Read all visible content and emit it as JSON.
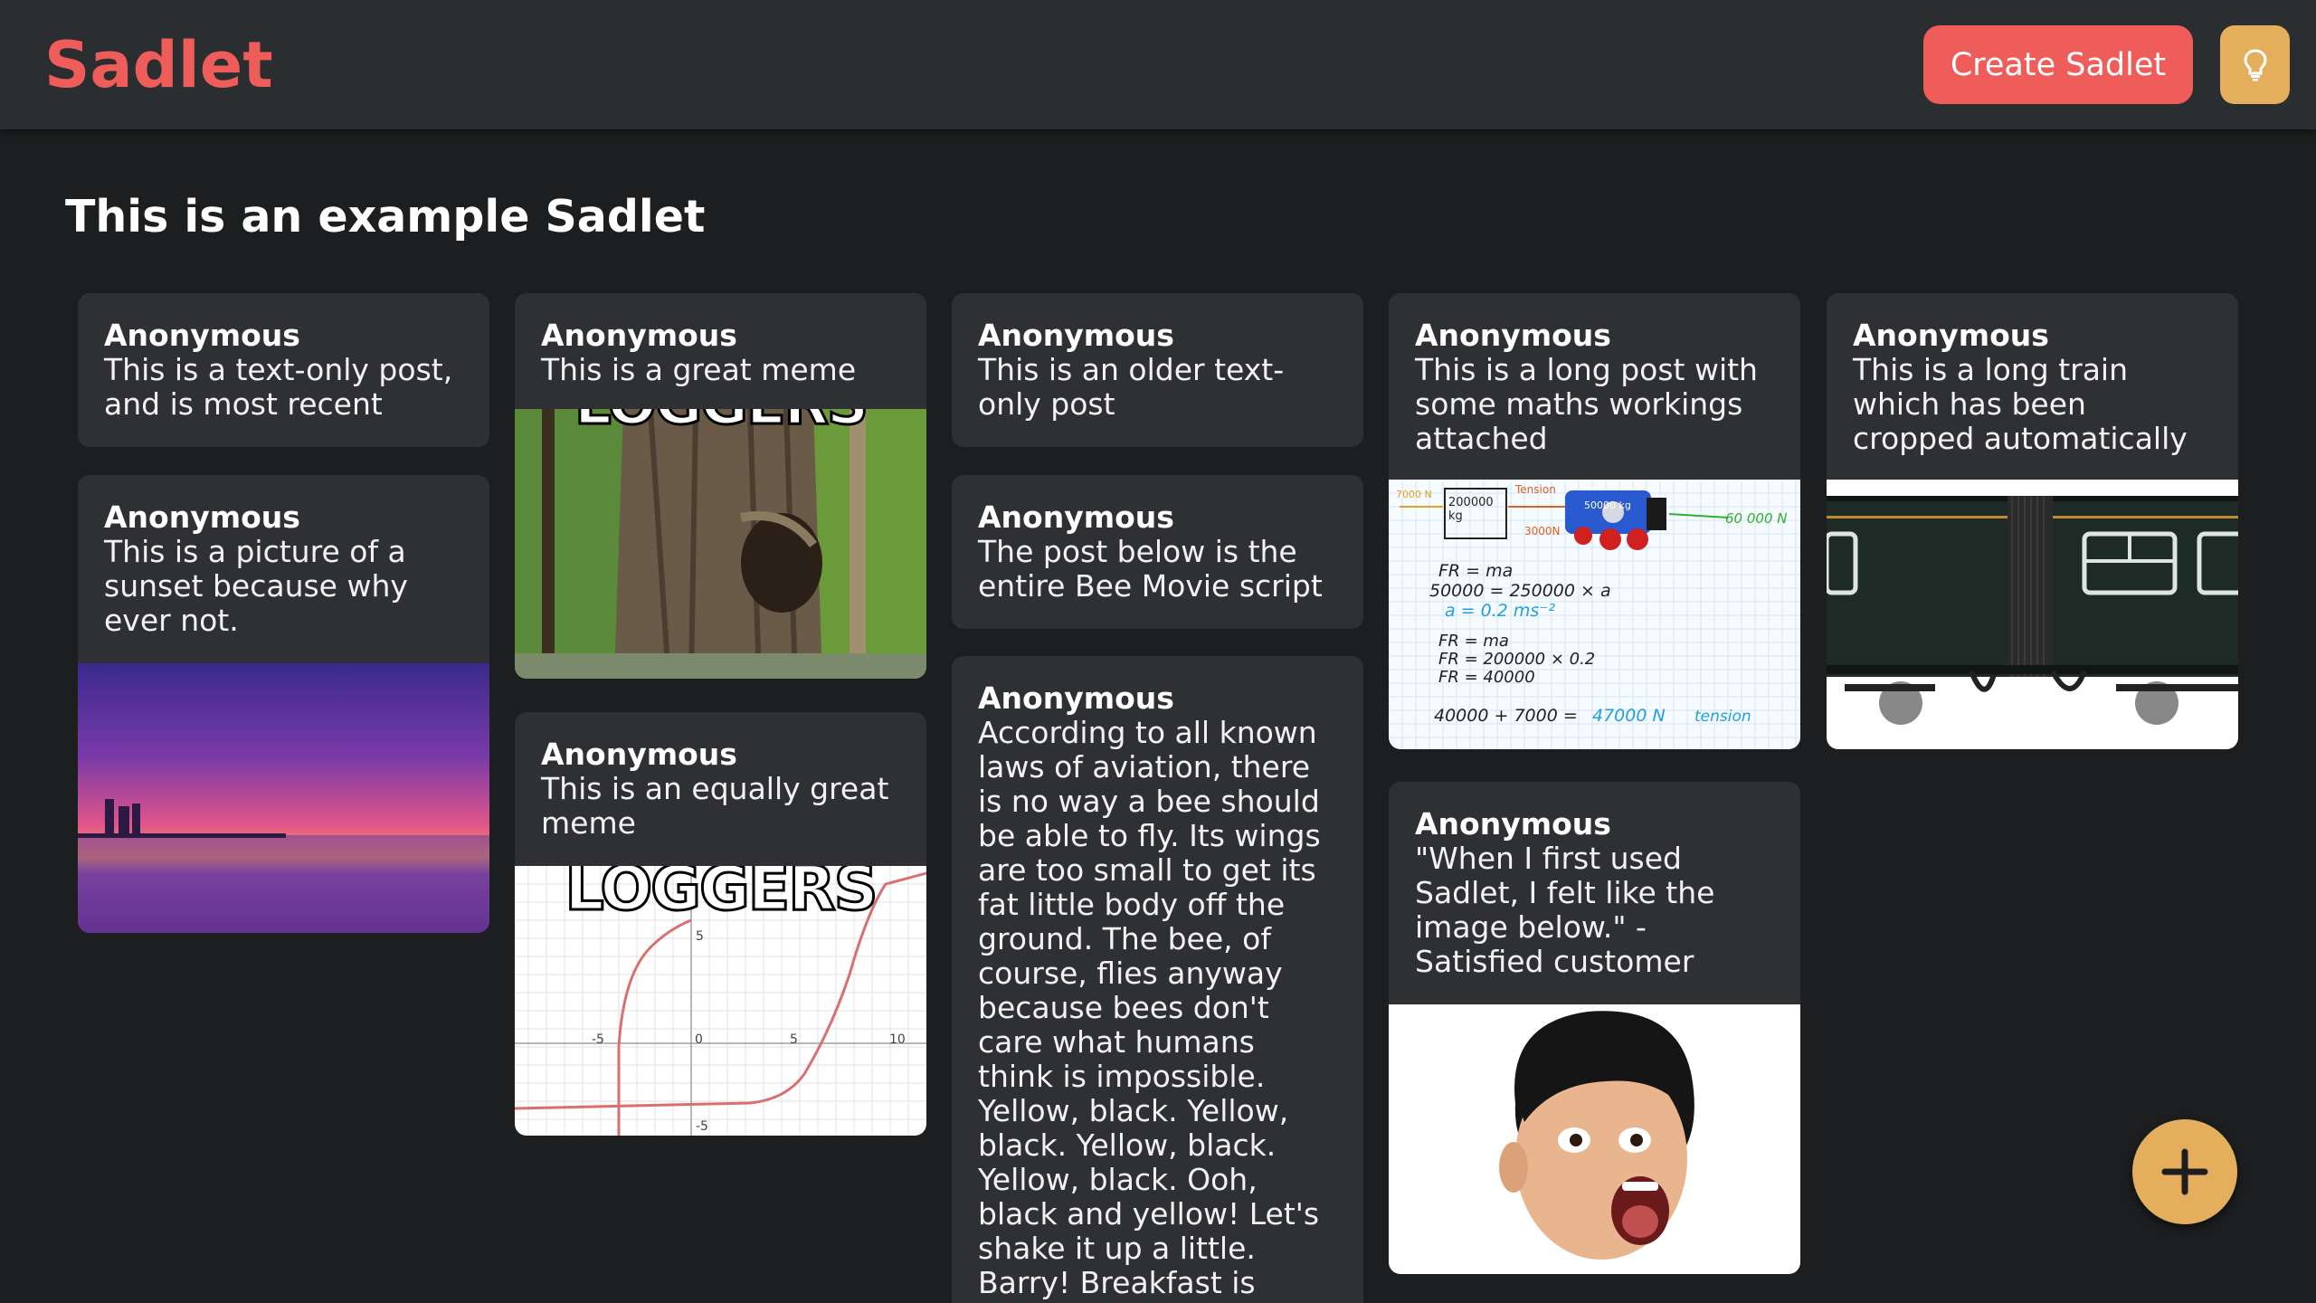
{
  "header": {
    "brand": "Sadlet",
    "create_label": "Create Sadlet"
  },
  "page_title": "This is an example Sadlet",
  "posts": [
    {
      "author": "Anonymous",
      "text": "This is a text-only post, and is most recent"
    },
    {
      "author": "Anonymous",
      "text": "This is a picture of a sunset because why ever not.",
      "image": "sunset-image"
    },
    {
      "author": "Anonymous",
      "text": "This is a great meme",
      "image": "tree-loggers-meme",
      "meme_caption": "LOGGERS"
    },
    {
      "author": "Anonymous",
      "text": "This is an equally great meme",
      "image": "graph-loggers-meme",
      "meme_caption": "LOGGERS",
      "tick_labels": [
        "-5",
        "0",
        "5",
        "10",
        "5",
        "-5"
      ]
    },
    {
      "author": "Anonymous",
      "text": "This is an older text-only post"
    },
    {
      "author": "Anonymous",
      "text": "The post below is the entire Bee Movie script"
    },
    {
      "author": "Anonymous",
      "text": "According to all known laws of aviation, there is no way a bee should be able to fly. Its wings are too small to get its fat little body off the ground. The bee, of course, flies anyway because bees don't care what humans think is impossible. Yellow, black. Yellow, black. Yellow, black. Yellow, black. Ooh, black and yellow! Let's shake it up a little. Barry! Breakfast is ready! Coming! Hang"
    },
    {
      "author": "Anonymous",
      "text": "This is a long post with some maths workings attached",
      "image": "maths-workings-image",
      "maths": {
        "l1": "7000 N",
        "l2": "200000 kg",
        "l3": "Tension",
        "l4": "50000 kg",
        "l5": "3000N",
        "l6": "60 000 N",
        "e1": "FR = ma",
        "e2": "50000 = 250000 × a",
        "e3": "a = 0.2 ms⁻²",
        "e4": "FR = ma",
        "e5": "FR = 200000 × 0.2",
        "e6": "FR = 40000",
        "e7a": "40000 + 7000 =",
        "e7b": "47000 N",
        "e7c": "tension"
      }
    },
    {
      "author": "Anonymous",
      "text": "\"When I first used Sadlet, I felt like the image below.\" - Satisfied customer",
      "image": "surprised-face-image"
    },
    {
      "author": "Anonymous",
      "text": "This is a long train which has been cropped automatically",
      "image": "train-image"
    }
  ],
  "colors": {
    "brand": "#ee5d5a",
    "accent": "#e4ae5c",
    "card": "#2e3033",
    "background": "#1c1e1f"
  },
  "icons": {
    "theme": "lightbulb-icon",
    "add": "plus-icon"
  }
}
